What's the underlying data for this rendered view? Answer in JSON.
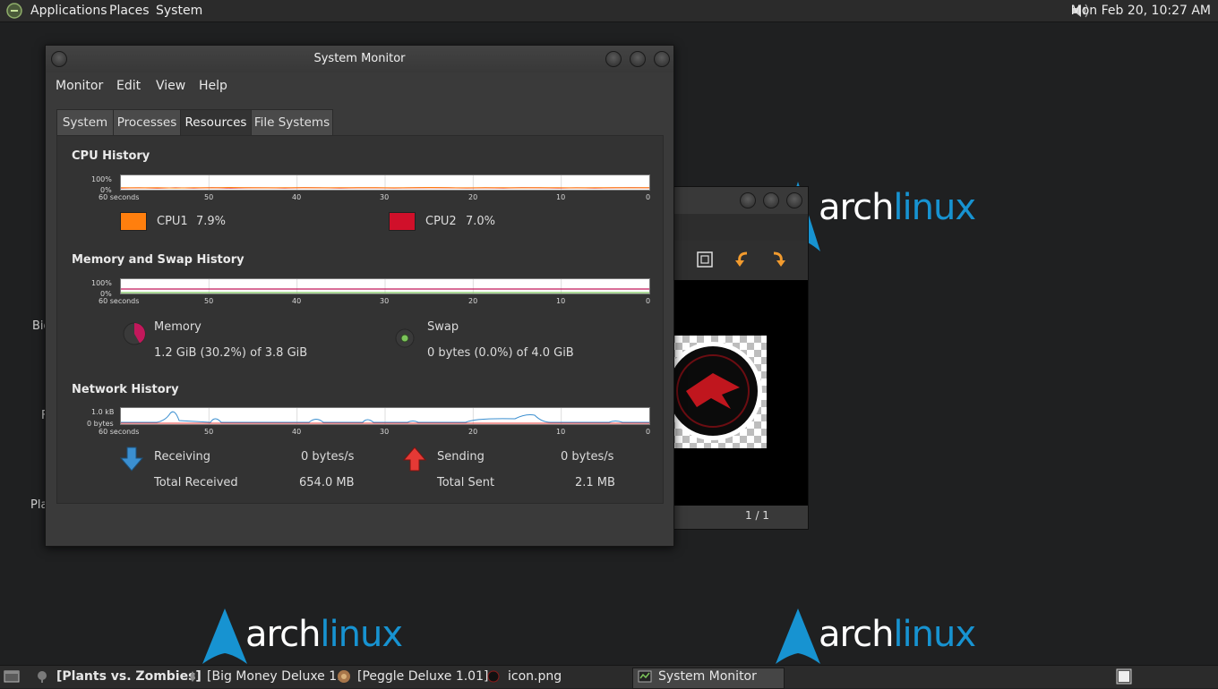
{
  "top_panel": {
    "menus": [
      "Applications",
      "Places",
      "System"
    ],
    "clock": "Mon Feb 20, 10:27 AM"
  },
  "desktop": {
    "partial_labels": [
      "Big",
      "F",
      "Pla"
    ],
    "logo_text_a": "arch",
    "logo_text_b": "linux"
  },
  "viewer": {
    "page_indicator": "1 / 1"
  },
  "sysmon": {
    "title": "System Monitor",
    "menus": [
      "Monitor",
      "Edit",
      "View",
      "Help"
    ],
    "tabs": [
      "System",
      "Processes",
      "Resources",
      "File Systems"
    ],
    "active_tab": "Resources",
    "graph_ticks": [
      "60 seconds",
      "50",
      "40",
      "30",
      "20",
      "10",
      "0"
    ],
    "cpu": {
      "title": "CPU History",
      "y_top": "100%",
      "y_bottom": "0%",
      "cpu1_label": "CPU1",
      "cpu1_value": "7.9%",
      "cpu1_color": "#ff7f0e",
      "cpu2_label": "CPU2",
      "cpu2_value": "7.0%",
      "cpu2_color": "#d0102a",
      "cpu1_series": [
        8,
        7,
        9,
        6,
        8,
        7,
        10,
        8,
        7,
        9,
        8,
        7,
        9,
        8,
        8,
        7,
        9,
        10,
        8,
        7,
        8,
        9,
        7,
        8,
        8,
        7,
        9,
        8,
        7,
        8
      ],
      "cpu2_series": [
        6,
        7,
        5,
        7,
        6,
        8,
        6,
        7,
        7,
        6,
        8,
        7,
        6,
        7,
        7,
        6,
        7,
        8,
        7,
        6,
        7,
        6,
        8,
        7,
        6,
        7,
        6,
        7,
        8,
        7
      ]
    },
    "memory": {
      "title": "Memory and Swap History",
      "y_top": "100%",
      "y_bottom": "0%",
      "memory_label": "Memory",
      "memory_value": "1.2 GiB (30.2%) of 3.8 GiB",
      "memory_color": "#c2185b",
      "swap_label": "Swap",
      "swap_value": "0 bytes (0.0%) of 4.0 GiB",
      "swap_color": "#7cc45a"
    },
    "network": {
      "title": "Network History",
      "y_top": "1.0 kB",
      "y_bottom": "0 bytes",
      "receiving_label": "Receiving",
      "receiving_rate": "0 bytes/s",
      "total_received_label": "Total Received",
      "total_received": "654.0 MB",
      "sending_label": "Sending",
      "sending_rate": "0 bytes/s",
      "total_sent_label": "Total Sent",
      "total_sent": "2.1 MB",
      "receive_color": "#3b8fd0",
      "send_color": "#e53935"
    }
  },
  "taskbar": {
    "items": [
      "[Plants vs. Zombies]",
      "[Big Money Deluxe 1…",
      "[Peggle Deluxe 1.01]",
      "icon.png",
      "System Monitor"
    ]
  }
}
